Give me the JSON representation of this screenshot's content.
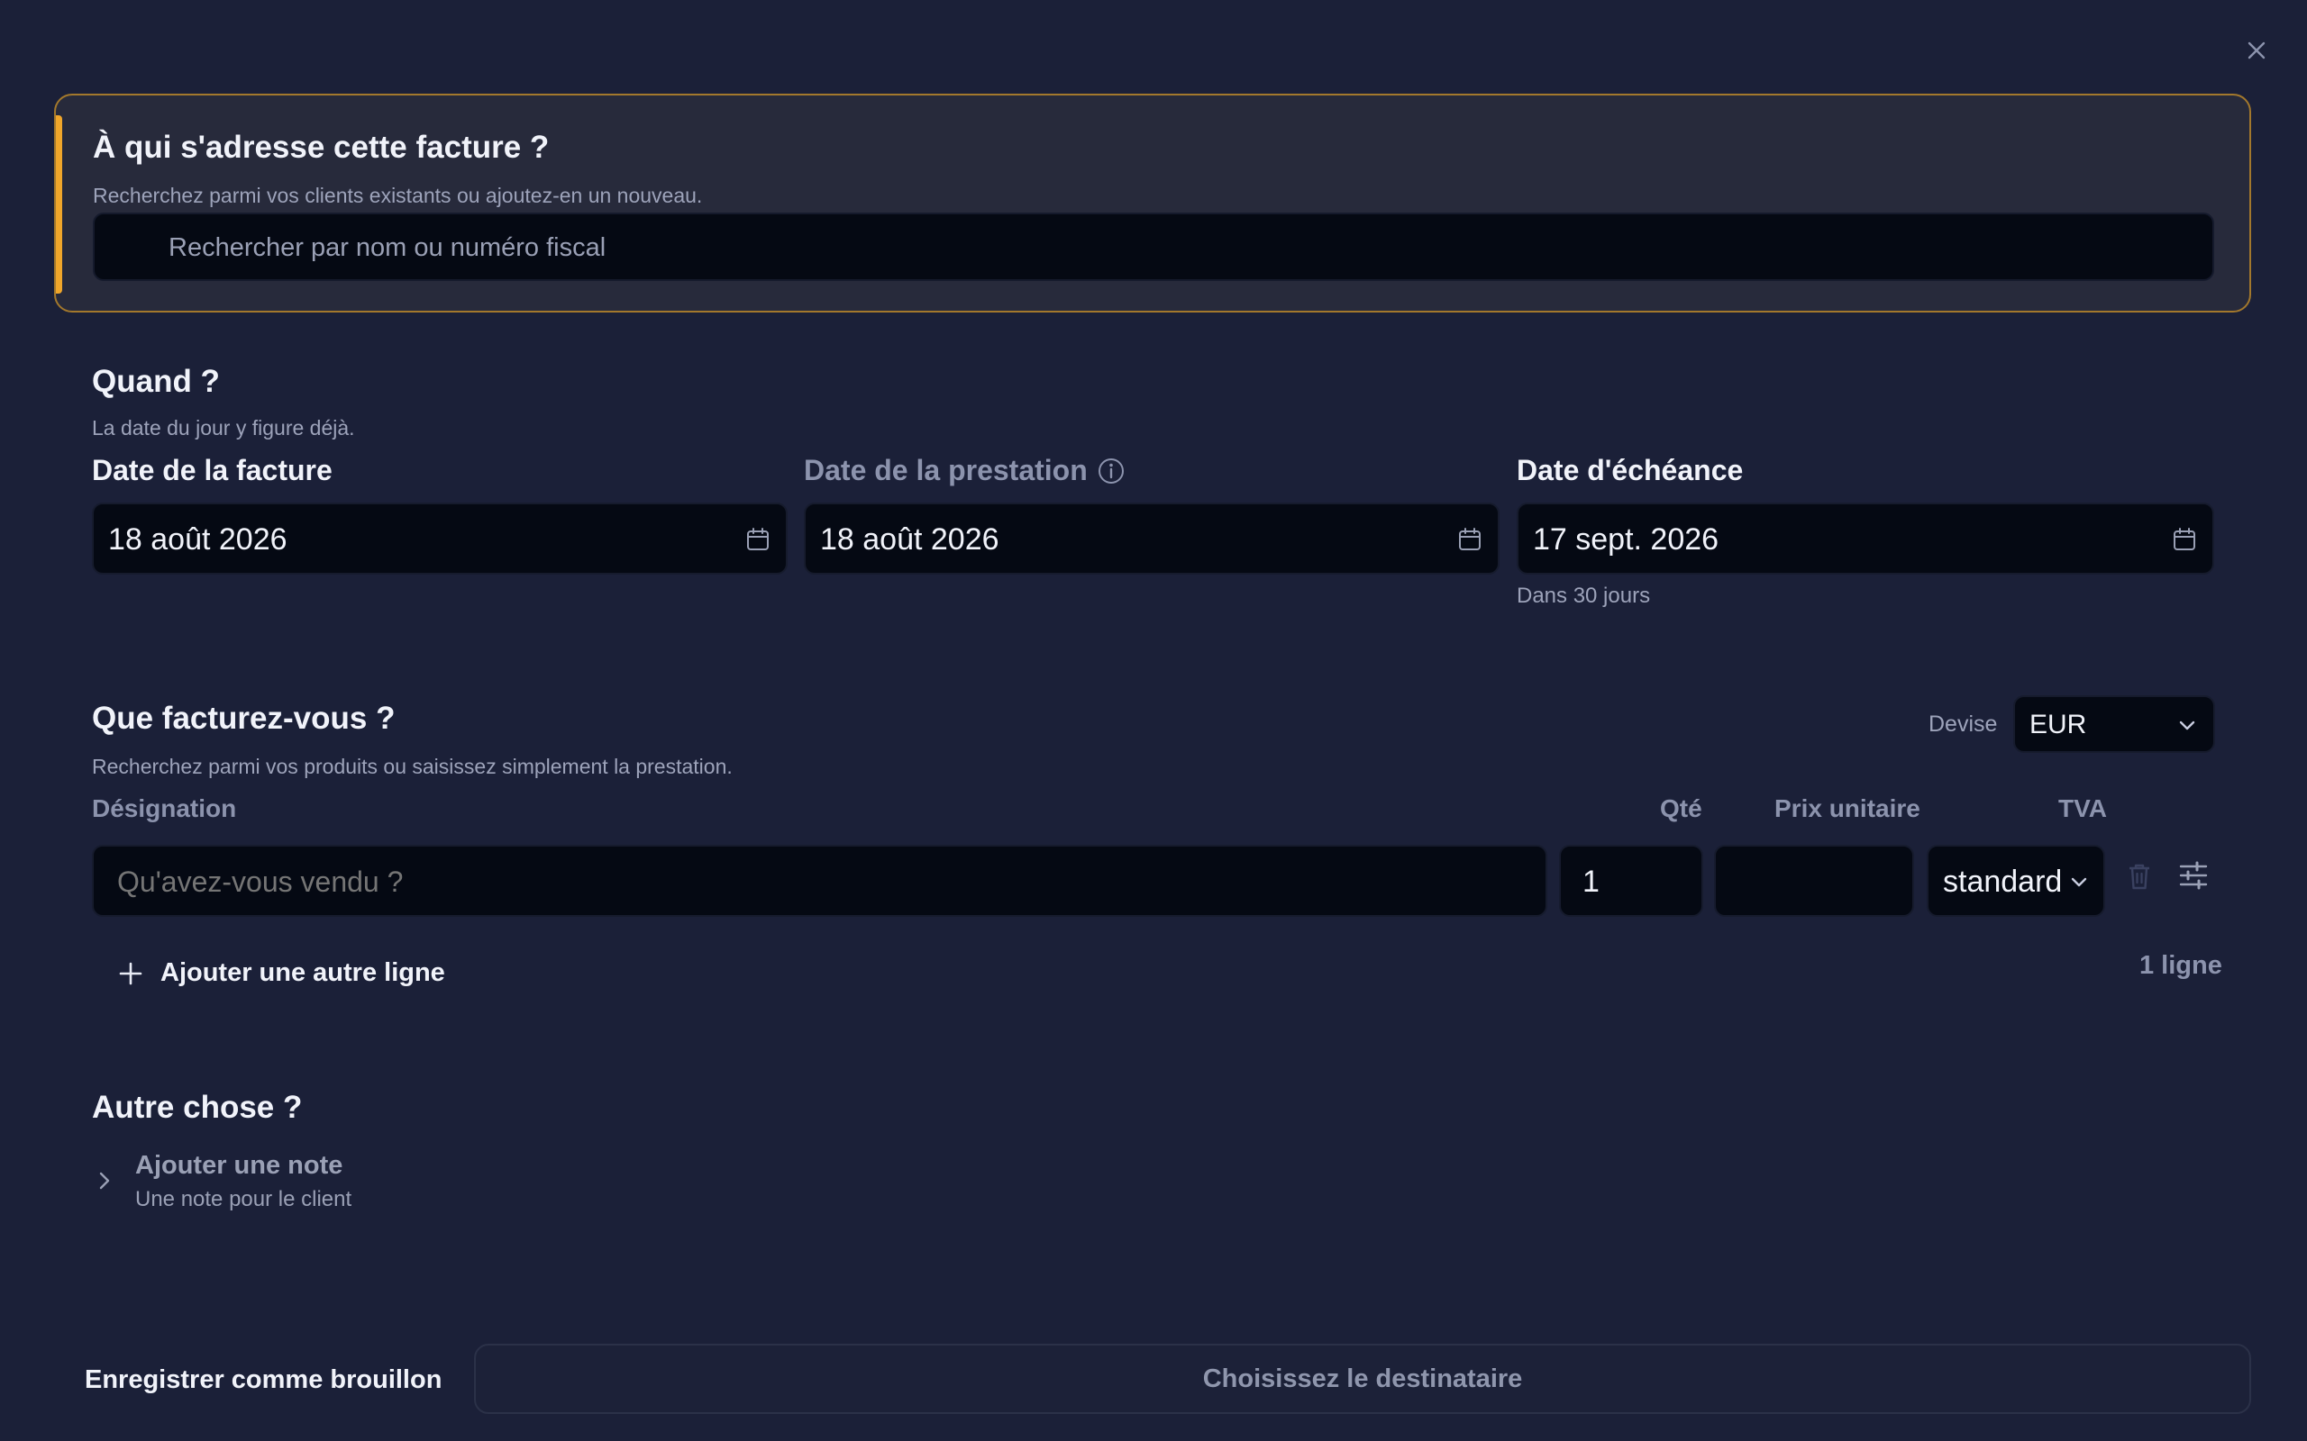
{
  "recipient": {
    "title": "À qui s'adresse cette facture ?",
    "subtitle": "Recherchez parmi vos clients existants ou ajoutez-en un nouveau.",
    "search_placeholder": "Rechercher par nom ou numéro fiscal",
    "accent_color": "#f0a62a"
  },
  "when": {
    "title": "Quand ?",
    "subtitle": "La date du jour y figure déjà.",
    "invoice_date_label": "Date de la facture",
    "invoice_date_value": "18 août 2026",
    "service_date_label": "Date de la prestation",
    "service_date_value": "18 août 2026",
    "due_date_label": "Date d'échéance",
    "due_date_value": "17 sept. 2026",
    "due_hint": "Dans 30 jours"
  },
  "items": {
    "title": "Que facturez-vous ?",
    "subtitle": "Recherchez parmi vos produits ou saisissez simplement la prestation.",
    "currency_label": "Devise",
    "currency_value": "EUR",
    "columns": {
      "designation": "Désignation",
      "qty": "Qté",
      "unit_price": "Prix unitaire",
      "vat": "TVA"
    },
    "row": {
      "designation_placeholder": "Qu'avez-vous vendu ?",
      "qty": "1",
      "unit_price": "",
      "vat": "standard"
    },
    "add_line_label": "Ajouter une autre ligne",
    "line_count": "1 ligne"
  },
  "other": {
    "title": "Autre chose ?",
    "note_title": "Ajouter une note",
    "note_subtitle": "Une note pour le client"
  },
  "footer": {
    "draft_label": "Enregistrer comme brouillon",
    "submit_label": "Choisissez le destinataire"
  }
}
